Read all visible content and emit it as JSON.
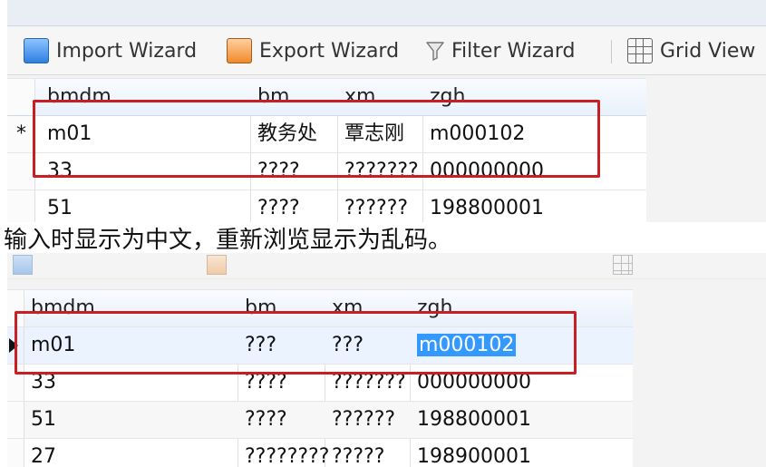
{
  "top": {
    "toolbar": {
      "import_label": "Import Wizard",
      "export_label": "Export Wizard",
      "filter_label": "Filter Wizard",
      "grid_label": "Grid View"
    },
    "columns": [
      "bmdm",
      "bm",
      "xm",
      "zgh"
    ],
    "row_marker": "*",
    "rows": [
      [
        "m01",
        "教务处",
        "覃志刚",
        "m000102"
      ],
      [
        "33",
        "????",
        "???????",
        "000000000"
      ],
      [
        "51",
        "????",
        "??????",
        "198800001"
      ]
    ]
  },
  "caption": "输入时显示为中文，重新浏览显示为乱码。",
  "bottom": {
    "columns": [
      "bmdm",
      "bm",
      "xm",
      "zgh"
    ],
    "rows": [
      [
        "m01",
        "???",
        "???",
        "m000102"
      ],
      [
        "33",
        "????",
        "???????",
        "000000000"
      ],
      [
        "51",
        "????",
        "??????",
        "198800001"
      ],
      [
        "27",
        "????????",
        "?????",
        "198900001"
      ]
    ]
  },
  "colors": {
    "highlight_box": "#c81e24",
    "selection": "#3399ff"
  }
}
